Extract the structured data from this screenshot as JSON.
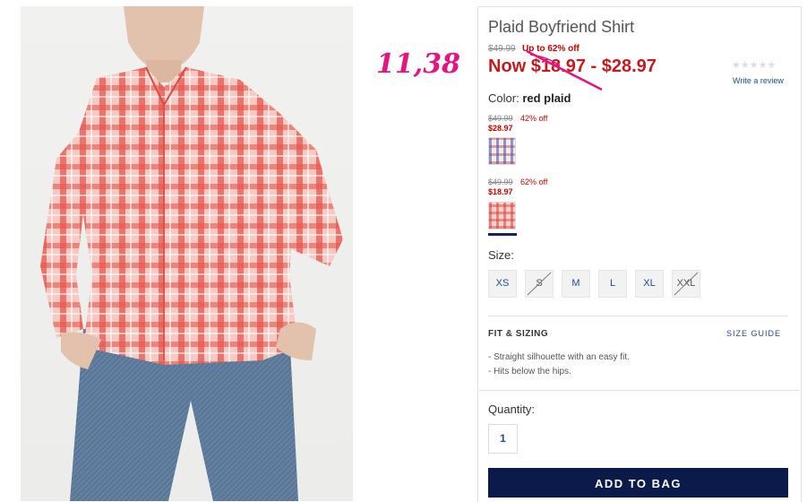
{
  "product": {
    "title": "Plaid Boyfriend Shirt",
    "original_price": "$49.99",
    "discount": "Up to 62% off",
    "now_price": "Now $18.97 - $28.97",
    "write_review": "Write a review",
    "rating_stars": "★★★★★"
  },
  "annotation": {
    "handwritten_price": "11,38"
  },
  "color": {
    "label": "Color:",
    "selected": "red plaid",
    "variants": [
      {
        "original": "$49.99",
        "off": "42% off",
        "now": "$28.97",
        "swatch": "blue-red-plaid"
      },
      {
        "original": "$49.99",
        "off": "62% off",
        "now": "$18.97",
        "swatch": "red-plaid"
      }
    ]
  },
  "size": {
    "label": "Size:",
    "options": [
      {
        "label": "XS",
        "available": true
      },
      {
        "label": "S",
        "available": false
      },
      {
        "label": "M",
        "available": true
      },
      {
        "label": "L",
        "available": true
      },
      {
        "label": "XL",
        "available": true
      },
      {
        "label": "XXL",
        "available": false
      }
    ]
  },
  "fit": {
    "title": "FIT & SIZING",
    "size_guide": "SIZE GUIDE",
    "bullets": [
      "- Straight silhouette with an easy fit.",
      "- Hits below the hips."
    ]
  },
  "quantity": {
    "label": "Quantity:",
    "value": "1"
  },
  "add_to_bag": "ADD TO BAG",
  "colors": {
    "sale_red": "#c41b20",
    "link_blue": "#1c4d8c",
    "button_navy": "#0a1a4a",
    "annotation_pink": "#e6147e"
  }
}
